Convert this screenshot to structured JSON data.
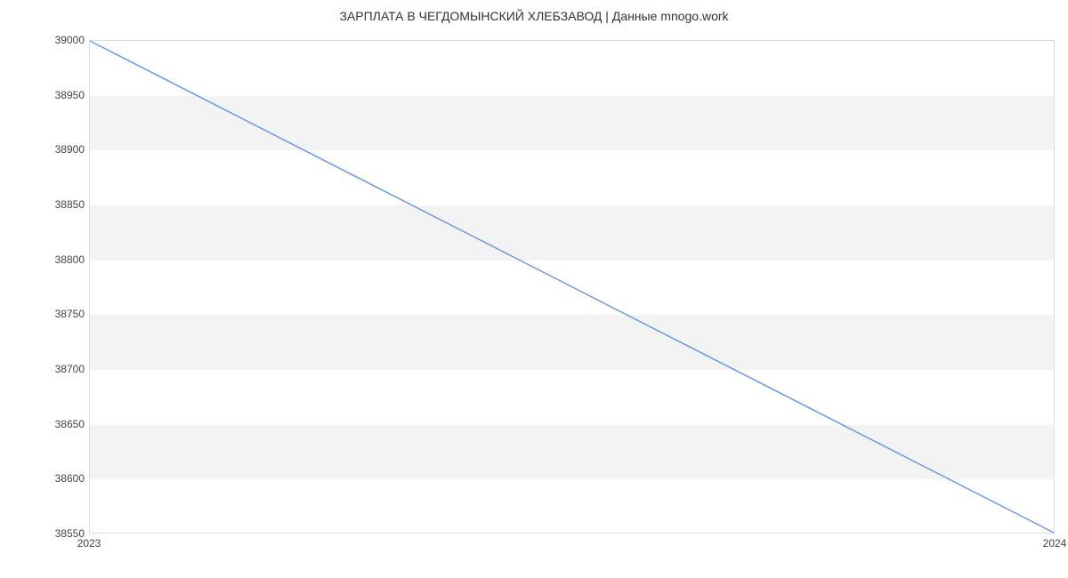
{
  "chart_data": {
    "type": "line",
    "title": "ЗАРПЛАТА В ЧЕГДОМЫНСКИЙ ХЛЕБЗАВОД | Данные mnogo.work",
    "x": [
      2023,
      2024
    ],
    "values": [
      39000,
      38550
    ],
    "xlabel": "",
    "ylabel": "",
    "xlim": [
      2023,
      2024
    ],
    "ylim": [
      38550,
      39000
    ],
    "x_ticks": [
      2023,
      2024
    ],
    "y_ticks": [
      38550,
      38600,
      38650,
      38700,
      38750,
      38800,
      38850,
      38900,
      38950,
      39000
    ]
  }
}
